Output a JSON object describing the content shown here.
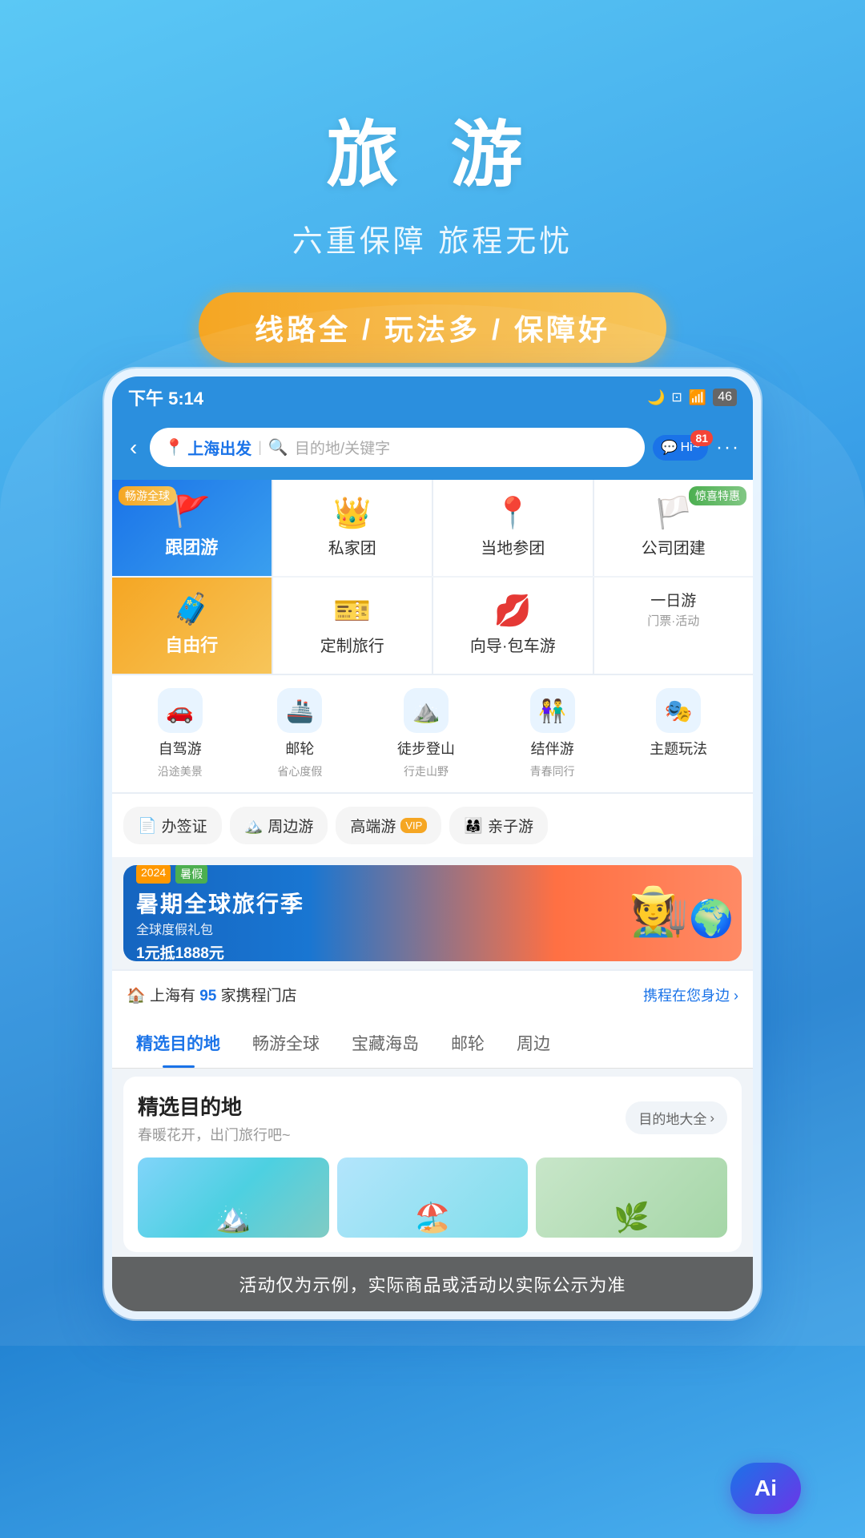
{
  "hero": {
    "title": "旅 游",
    "subtitle": "六重保障 旅程无忧",
    "badge": "线路全 / 玩法多 / 保障好"
  },
  "statusBar": {
    "time": "下午 5:14",
    "icons": "🌙"
  },
  "navBar": {
    "backLabel": "‹",
    "searchOriginIcon": "📍",
    "searchOrigin": "上海出发",
    "searchPlaceholder": "目的地/关键字",
    "chatLabel": "Hi~",
    "chatBadge": "81"
  },
  "gridItems": [
    {
      "id": "group-tour",
      "label": "跟团游",
      "tag": "畅游全球",
      "featured": "blue"
    },
    {
      "id": "private-tour",
      "label": "私家团",
      "tag": ""
    },
    {
      "id": "local-tour",
      "label": "当地参团",
      "tag": ""
    },
    {
      "id": "company-tour",
      "label": "公司团建",
      "tag": "惊喜特惠"
    },
    {
      "id": "free-travel",
      "label": "自由行",
      "tag": "",
      "featured": "orange"
    },
    {
      "id": "custom-travel",
      "label": "定制旅行",
      "tag": ""
    },
    {
      "id": "guide-tour",
      "label": "向导·包车游",
      "tag": ""
    },
    {
      "id": "one-day",
      "label": "一日游",
      "sublabel": "门票·活动",
      "tag": ""
    }
  ],
  "serviceRow": [
    {
      "id": "self-drive",
      "label": "自驾游",
      "sublabel": "沿途美景"
    },
    {
      "id": "cruise",
      "label": "邮轮",
      "sublabel": "省心度假"
    },
    {
      "id": "hiking",
      "label": "徒步登山",
      "sublabel": "行走山野"
    },
    {
      "id": "companion",
      "label": "结伴游",
      "sublabel": "青春同行"
    },
    {
      "id": "theme",
      "label": "主题玩法",
      "sublabel": ""
    }
  ],
  "tagsRow": [
    {
      "id": "visa",
      "label": "办签证"
    },
    {
      "id": "nearby",
      "label": "周边游"
    },
    {
      "id": "luxury",
      "label": "高端游",
      "badge": "VIP"
    },
    {
      "id": "family",
      "label": "亲子游"
    }
  ],
  "banner": {
    "tag1": "2024",
    "tag2": "暑假",
    "title": "暑期全球旅行季",
    "subtitle": "全球度假礼包",
    "promo": "1元抵1888元"
  },
  "storeInfo": {
    "prefix": "上海有",
    "count": "95",
    "suffix": "家携程门店",
    "link": "携程在您身边 ›"
  },
  "tabs": [
    {
      "id": "selected-dest",
      "label": "精选目的地",
      "active": true
    },
    {
      "id": "global",
      "label": "畅游全球"
    },
    {
      "id": "island",
      "label": "宝藏海岛"
    },
    {
      "id": "cruise",
      "label": "邮轮"
    },
    {
      "id": "nearby",
      "label": "周边"
    }
  ],
  "destSection": {
    "title": "精选目的地",
    "subtitle": "春暖花开，出门旅行吧~",
    "btnLabel": "目的地大全",
    "btnIcon": "›"
  },
  "footer": {
    "disclaimer": "活动仅为示例，实际商品或活动以实际公示为准"
  },
  "aiButton": {
    "label": "Ai"
  }
}
